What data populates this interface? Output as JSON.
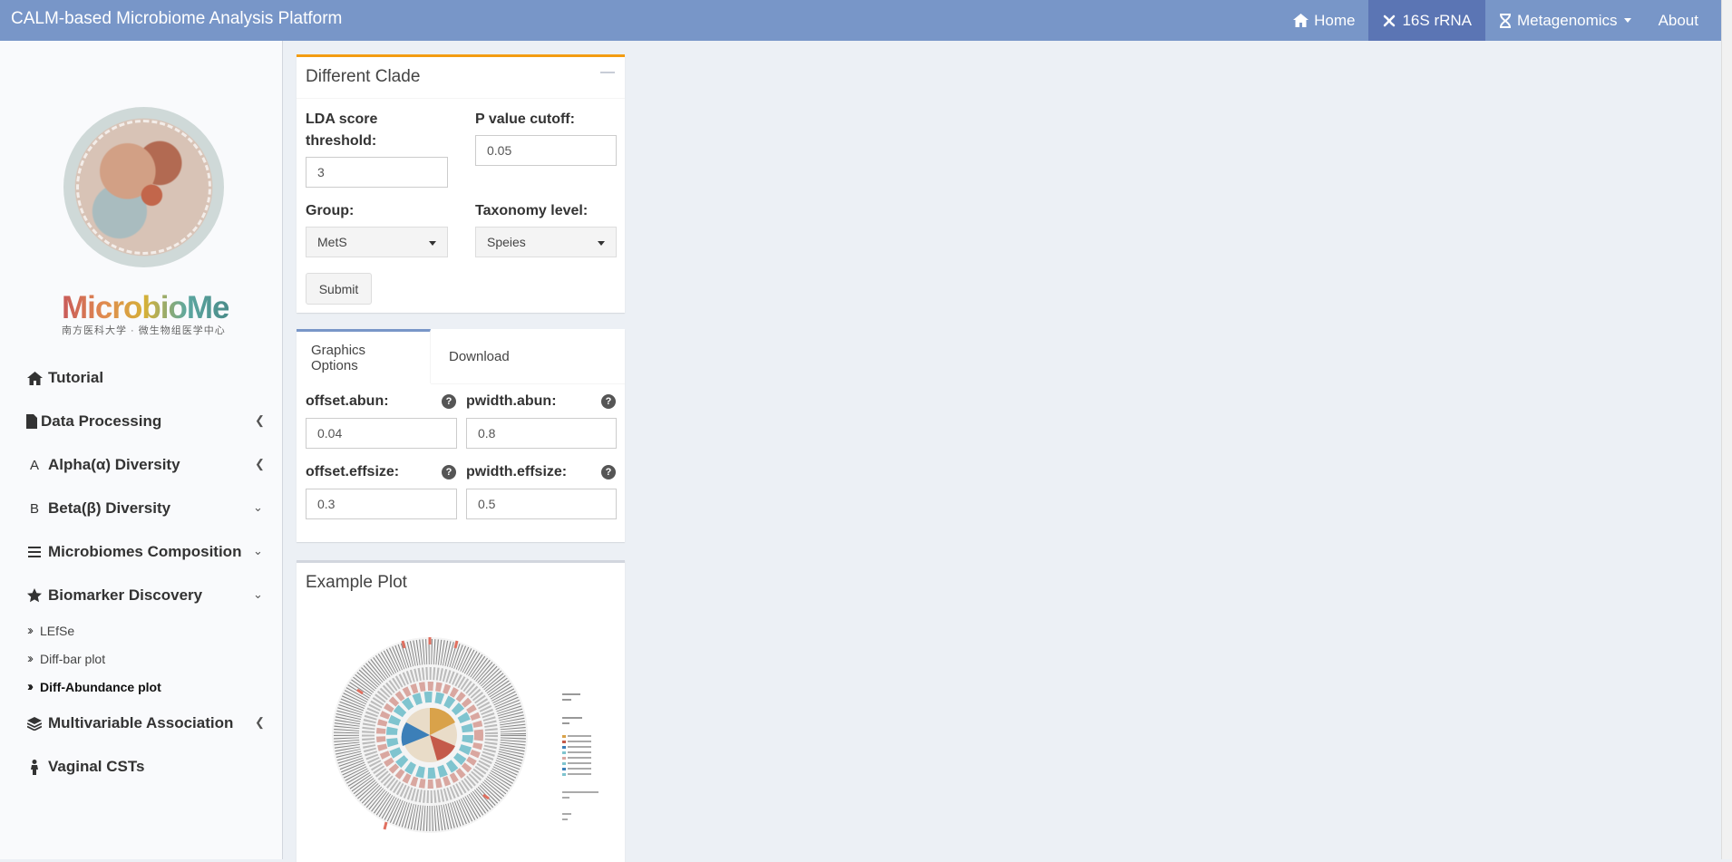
{
  "header": {
    "brand": "CALM-based Microbiome Analysis Platform",
    "nav": [
      {
        "label": "Home",
        "icon": "home-icon"
      },
      {
        "label": "16S rRNA",
        "icon": "dna-icon"
      },
      {
        "label": "Metagenomics",
        "icon": "dna-strand-icon"
      },
      {
        "label": "About"
      }
    ],
    "bg_color": "#7896c8",
    "active_color": "#5b75b4"
  },
  "sidebar": {
    "logo_text": "MicrobioMe",
    "logo_subtitle": "南方医科大学 · 微生物组医学中心",
    "menu": [
      {
        "label": "Tutorial",
        "icon": "home-icon"
      },
      {
        "label": "Data Processing",
        "icon": "file-icon"
      },
      {
        "label": "Alpha(α) Diversity",
        "icon": "alpha-icon",
        "glyph": "Α"
      },
      {
        "label": "Beta(β) Diversity",
        "icon": "beta-icon",
        "glyph": "Β"
      },
      {
        "label": "Microbiomes Composition",
        "icon": "bars-icon"
      },
      {
        "label": "Biomarker Discovery",
        "icon": "star-icon"
      },
      {
        "label": "Multivariable Association",
        "icon": "layers-icon"
      },
      {
        "label": "Vaginal CSTs",
        "icon": "person-icon"
      }
    ],
    "submenu": [
      {
        "label": "LEfSe"
      },
      {
        "label": "Diff-bar plot"
      },
      {
        "label": "Diff-Abundance plot"
      }
    ]
  },
  "clade_box": {
    "title": "Different Clade",
    "lda_label": "LDA score threshold:",
    "lda_value": "3",
    "pvalue_label": "P value cutoff:",
    "pvalue_value": "0.05",
    "group_label": "Group:",
    "group_value": "MetS",
    "taxonomy_label": "Taxonomy level:",
    "taxonomy_value": "Speies",
    "submit_label": "Submit",
    "accent_color": "#f39c12"
  },
  "options_box": {
    "tabs": [
      "Graphics Options",
      "Download"
    ],
    "fields": [
      {
        "label": "offset.abun:",
        "value": "0.04"
      },
      {
        "label": "pwidth.abun:",
        "value": "0.8"
      },
      {
        "label": "offset.effsize:",
        "value": "0.3"
      },
      {
        "label": "pwidth.effsize:",
        "value": "0.5"
      }
    ],
    "help_glyph": "?"
  },
  "plot_box": {
    "title": "Example Plot"
  }
}
